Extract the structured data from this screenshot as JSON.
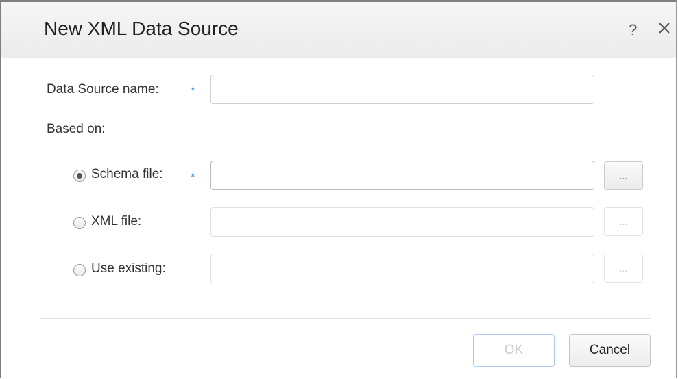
{
  "dialog": {
    "title": "New XML Data Source",
    "help_icon": "?",
    "close_icon": "close-icon"
  },
  "form": {
    "name_label": "Data Source name:",
    "name_value": "",
    "required_marker": "*",
    "based_on_label": "Based on:",
    "options": [
      {
        "label": "Schema file:",
        "selected": true,
        "required": true,
        "value": "",
        "browse_label": "...",
        "enabled": true
      },
      {
        "label": "XML file:",
        "selected": false,
        "required": false,
        "value": "",
        "browse_label": "...",
        "enabled": false
      },
      {
        "label": "Use existing:",
        "selected": false,
        "required": false,
        "value": "",
        "browse_label": "...",
        "enabled": false
      }
    ]
  },
  "footer": {
    "ok_label": "OK",
    "cancel_label": "Cancel"
  },
  "colors": {
    "required_marker": "#4a90e2",
    "ok_border": "#a9cbef",
    "titlebar": "#efefef"
  }
}
